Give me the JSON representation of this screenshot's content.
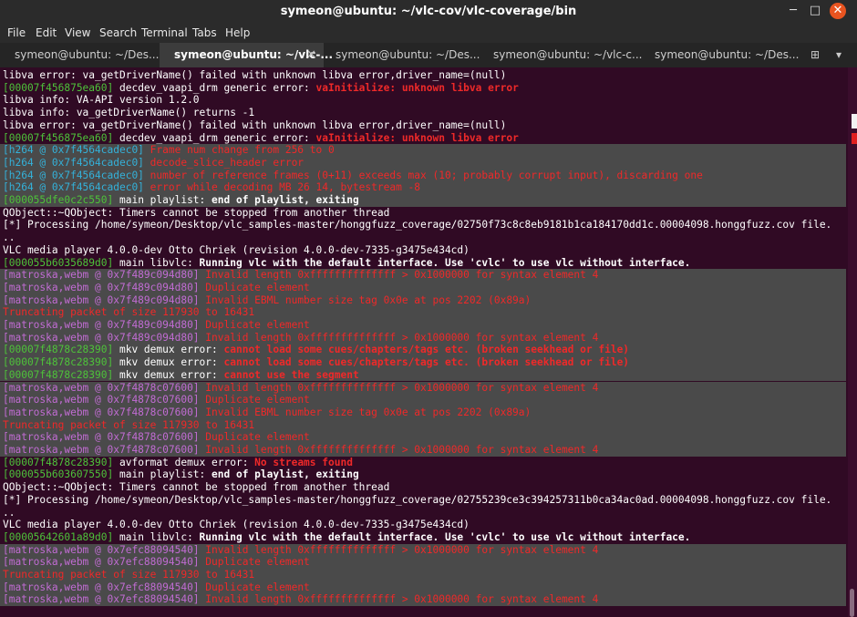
{
  "window": {
    "title": "symeon@ubuntu: ~/vlc-cov/vlc-coverage/bin",
    "minimize": "─",
    "maximize": "□",
    "close": "✕"
  },
  "menu": [
    "File",
    "Edit",
    "View",
    "Search",
    "Terminal",
    "Tabs",
    "Help"
  ],
  "tabs": [
    {
      "label": "symeon@ubuntu: ~/Des...",
      "active": false
    },
    {
      "label": "symeon@ubuntu: ~/vlc-...",
      "active": true
    },
    {
      "label": "symeon@ubuntu: ~/Des...",
      "active": false
    },
    {
      "label": "symeon@ubuntu: ~/vlc-c...",
      "active": false
    },
    {
      "label": "symeon@ubuntu: ~/Des...",
      "active": false
    }
  ],
  "tab_close_glyph": "✕",
  "new_tab_glyph": "⊞",
  "tab_menu_glyph": "▾",
  "colors": {
    "background": "#300a24",
    "green": "#4ec23a",
    "cyan": "#34b1d9",
    "magenta": "#c16cd3",
    "red": "#ef2929",
    "selection": "#4a4a4a",
    "accent": "#e95420"
  },
  "terminal": {
    "lines": [
      [
        [
          "w",
          "libva error: va_getDriverName() failed with unknown libva error,driver_name=(null)"
        ]
      ],
      [
        [
          "g",
          "[00007f456875ea60]"
        ],
        [
          "w",
          " decdev_vaapi_drm generic error: "
        ],
        [
          "rb",
          "vaInitialize: unknown libva error"
        ]
      ],
      [
        [
          "w",
          "libva info: VA-API version 1.2.0"
        ]
      ],
      [
        [
          "w",
          "libva info: va_getDriverName() returns -1"
        ]
      ],
      [
        [
          "w",
          "libva error: va_getDriverName() failed with unknown libva error,driver_name=(null)"
        ]
      ],
      [
        [
          "g",
          "[00007f456875ea60]"
        ],
        [
          "w",
          " decdev_vaapi_drm generic error: "
        ],
        [
          "rb",
          "vaInitialize: unknown libva error"
        ]
      ],
      [
        [
          "c",
          "[h264 @ 0x7f4564cadec0]"
        ],
        [
          "r",
          " Frame num change from 256 to 0"
        ]
      ],
      [
        [
          "c",
          "[h264 @ 0x7f4564cadec0]"
        ],
        [
          "r",
          " decode_slice_header error"
        ]
      ],
      [
        [
          "c",
          "[h264 @ 0x7f4564cadec0]"
        ],
        [
          "r",
          " number of reference frames (0+11) exceeds max (10; probably corrupt input), discarding one"
        ]
      ],
      [
        [
          "c",
          "[h264 @ 0x7f4564cadec0]"
        ],
        [
          "r",
          " error while decoding MB 26 14, bytestream -8"
        ]
      ],
      [
        [
          "g",
          "[000055dfe0c2c550]"
        ],
        [
          "w",
          " main playlist: "
        ],
        [
          "wb",
          "end of playlist, exiting"
        ]
      ],
      [
        [
          "w",
          "QObject::~QObject: Timers cannot be stopped from another thread"
        ]
      ],
      [
        [
          "w",
          "[*] Processing /home/symeon/Desktop/vlc_samples-master/honggfuzz_coverage/02750f73c8c8eb9181b1ca184170dd1c.00004098.honggfuzz.cov file."
        ]
      ],
      [
        [
          "w",
          ".."
        ]
      ],
      [
        [
          "w",
          "VLC media player 4.0.0-dev Otto Chriek (revision 4.0.0-dev-7335-g3475e434cd)"
        ]
      ],
      [
        [
          "g",
          "[000055b6035689d0]"
        ],
        [
          "w",
          " main libvlc: "
        ],
        [
          "wb",
          "Running vlc with the default interface. Use 'cvlc' to use vlc without interface."
        ]
      ],
      [
        [
          "m",
          "[matroska,webm @ 0x7f489c094d80]"
        ],
        [
          "r",
          " Invalid length 0xffffffffffffff > 0x1000000 for syntax element 4"
        ]
      ],
      [
        [
          "m",
          "[matroska,webm @ 0x7f489c094d80]"
        ],
        [
          "r",
          " Duplicate element"
        ]
      ],
      [
        [
          "m",
          "[matroska,webm @ 0x7f489c094d80]"
        ],
        [
          "r",
          " Invalid EBML number size tag 0x0e at pos 2202 (0x89a)"
        ]
      ],
      [
        [
          "r",
          "Truncating packet of size 117930 to 16431"
        ]
      ],
      [
        [
          "m",
          "[matroska,webm @ 0x7f489c094d80]"
        ],
        [
          "r",
          " Duplicate element"
        ]
      ],
      [
        [
          "m",
          "[matroska,webm @ 0x7f489c094d80]"
        ],
        [
          "r",
          " Invalid length 0xffffffffffffff > 0x1000000 for syntax element 4"
        ]
      ],
      [
        [
          "g",
          "[00007f4878c28390]"
        ],
        [
          "w",
          " mkv demux error: "
        ],
        [
          "rb",
          "cannot load some cues/chapters/tags etc. (broken seekhead or file)"
        ]
      ],
      [
        [
          "g",
          "[00007f4878c28390]"
        ],
        [
          "w",
          " mkv demux error: "
        ],
        [
          "rb",
          "cannot load some cues/chapters/tags etc. (broken seekhead or file)"
        ]
      ],
      [
        [
          "g",
          "[00007f4878c28390]"
        ],
        [
          "w",
          " mkv demux error: "
        ],
        [
          "rb",
          "cannot use the segment"
        ]
      ],
      [
        [
          "m",
          "[matroska,webm @ 0x7f4878c07600]"
        ],
        [
          "r",
          " Invalid length 0xffffffffffffff > 0x1000000 for syntax element 4"
        ]
      ],
      [
        [
          "m",
          "[matroska,webm @ 0x7f4878c07600]"
        ],
        [
          "r",
          " Duplicate element"
        ]
      ],
      [
        [
          "m",
          "[matroska,webm @ 0x7f4878c07600]"
        ],
        [
          "r",
          " Invalid EBML number size tag 0x0e at pos 2202 (0x89a)"
        ]
      ],
      [
        [
          "r",
          "Truncating packet of size 117930 to 16431"
        ]
      ],
      [
        [
          "m",
          "[matroska,webm @ 0x7f4878c07600]"
        ],
        [
          "r",
          " Duplicate element"
        ]
      ],
      [
        [
          "m",
          "[matroska,webm @ 0x7f4878c07600]"
        ],
        [
          "r",
          " Invalid length 0xffffffffffffff > 0x1000000 for syntax element 4"
        ]
      ],
      [
        [
          "g",
          "[00007f4878c28390]"
        ],
        [
          "w",
          " avformat demux error: "
        ],
        [
          "rb",
          "No streams found"
        ]
      ],
      [
        [
          "g",
          "[000055b603607550]"
        ],
        [
          "w",
          " main playlist: "
        ],
        [
          "wb",
          "end of playlist, exiting"
        ]
      ],
      [
        [
          "w",
          "QObject::~QObject: Timers cannot be stopped from another thread"
        ]
      ],
      [
        [
          "w",
          "[*] Processing /home/symeon/Desktop/vlc_samples-master/honggfuzz_coverage/02755239ce3c394257311b0ca34ac0ad.00004098.honggfuzz.cov file."
        ]
      ],
      [
        [
          "w",
          ".."
        ]
      ],
      [
        [
          "w",
          "VLC media player 4.0.0-dev Otto Chriek (revision 4.0.0-dev-7335-g3475e434cd)"
        ]
      ],
      [
        [
          "g",
          "[00005642601a89d0]"
        ],
        [
          "w",
          " main libvlc: "
        ],
        [
          "wb",
          "Running vlc with the default interface. Use 'cvlc' to use vlc without interface."
        ]
      ],
      [
        [
          "m",
          "[matroska,webm @ 0x7efc88094540]"
        ],
        [
          "r",
          " Invalid length 0xffffffffffffff > 0x1000000 for syntax element 4"
        ]
      ],
      [
        [
          "m",
          "[matroska,webm @ 0x7efc88094540]"
        ],
        [
          "r",
          " Duplicate element"
        ]
      ],
      [
        [
          "r",
          "Truncating packet of size 117930 to 16431"
        ]
      ],
      [
        [
          "m",
          "[matroska,webm @ 0x7efc88094540]"
        ],
        [
          "r",
          " Duplicate element"
        ]
      ],
      [
        [
          "m",
          "[matroska,webm @ 0x7efc88094540]"
        ],
        [
          "r",
          " Invalid length 0xffffffffffffff > 0x1000000 for syntax element 4"
        ]
      ]
    ],
    "selected_lines": [
      6,
      7,
      8,
      9,
      10,
      16,
      17,
      18,
      19,
      20,
      21,
      22,
      23,
      24,
      25,
      26,
      27,
      28,
      29,
      30,
      38,
      39,
      40,
      41,
      42
    ]
  }
}
